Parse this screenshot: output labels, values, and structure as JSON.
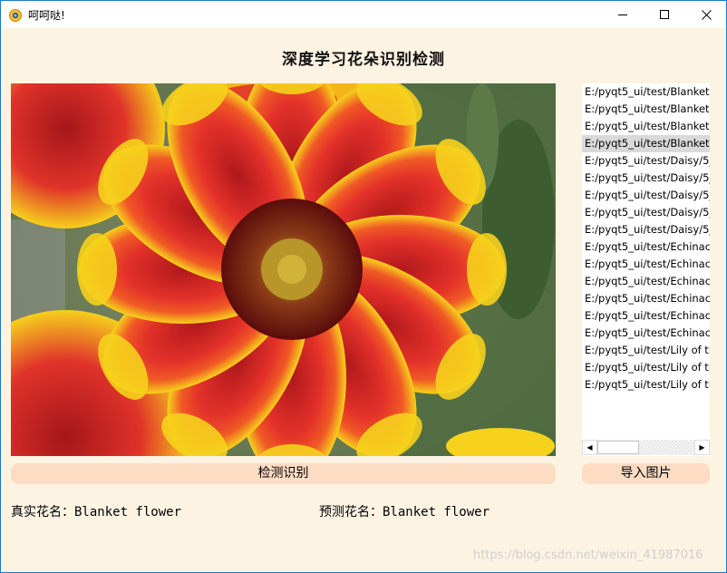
{
  "window": {
    "title": "呵呵哒!"
  },
  "heading": "深度学习花朵识别检测",
  "image": {
    "description_icon": "flower-photo"
  },
  "file_list": {
    "selected_index": 3,
    "items": [
      "E:/pyqt5_ui/test/Blanket",
      "E:/pyqt5_ui/test/Blanket",
      "E:/pyqt5_ui/test/Blanket",
      "E:/pyqt5_ui/test/Blanket",
      "E:/pyqt5_ui/test/Daisy/5_",
      "E:/pyqt5_ui/test/Daisy/5_",
      "E:/pyqt5_ui/test/Daisy/5_",
      "E:/pyqt5_ui/test/Daisy/5_",
      "E:/pyqt5_ui/test/Daisy/5_",
      "E:/pyqt5_ui/test/Echinac",
      "E:/pyqt5_ui/test/Echinac",
      "E:/pyqt5_ui/test/Echinac",
      "E:/pyqt5_ui/test/Echinac",
      "E:/pyqt5_ui/test/Echinac",
      "E:/pyqt5_ui/test/Echinac",
      "E:/pyqt5_ui/test/Lily of th",
      "E:/pyqt5_ui/test/Lily of th",
      "E:/pyqt5_ui/test/Lily of th"
    ]
  },
  "buttons": {
    "detect": "检测识别",
    "import": "导入图片"
  },
  "results": {
    "true_label": "真实花名：Blanket flower",
    "pred_label": "预测花名：Blanket flower"
  },
  "watermark": "https://blog.csdn.net/weixin_41987016",
  "colors": {
    "background": "#fdf3e3",
    "button": "#fcdcc3",
    "selected_row": "#d9d9d9",
    "window_border": "#1979ca"
  }
}
